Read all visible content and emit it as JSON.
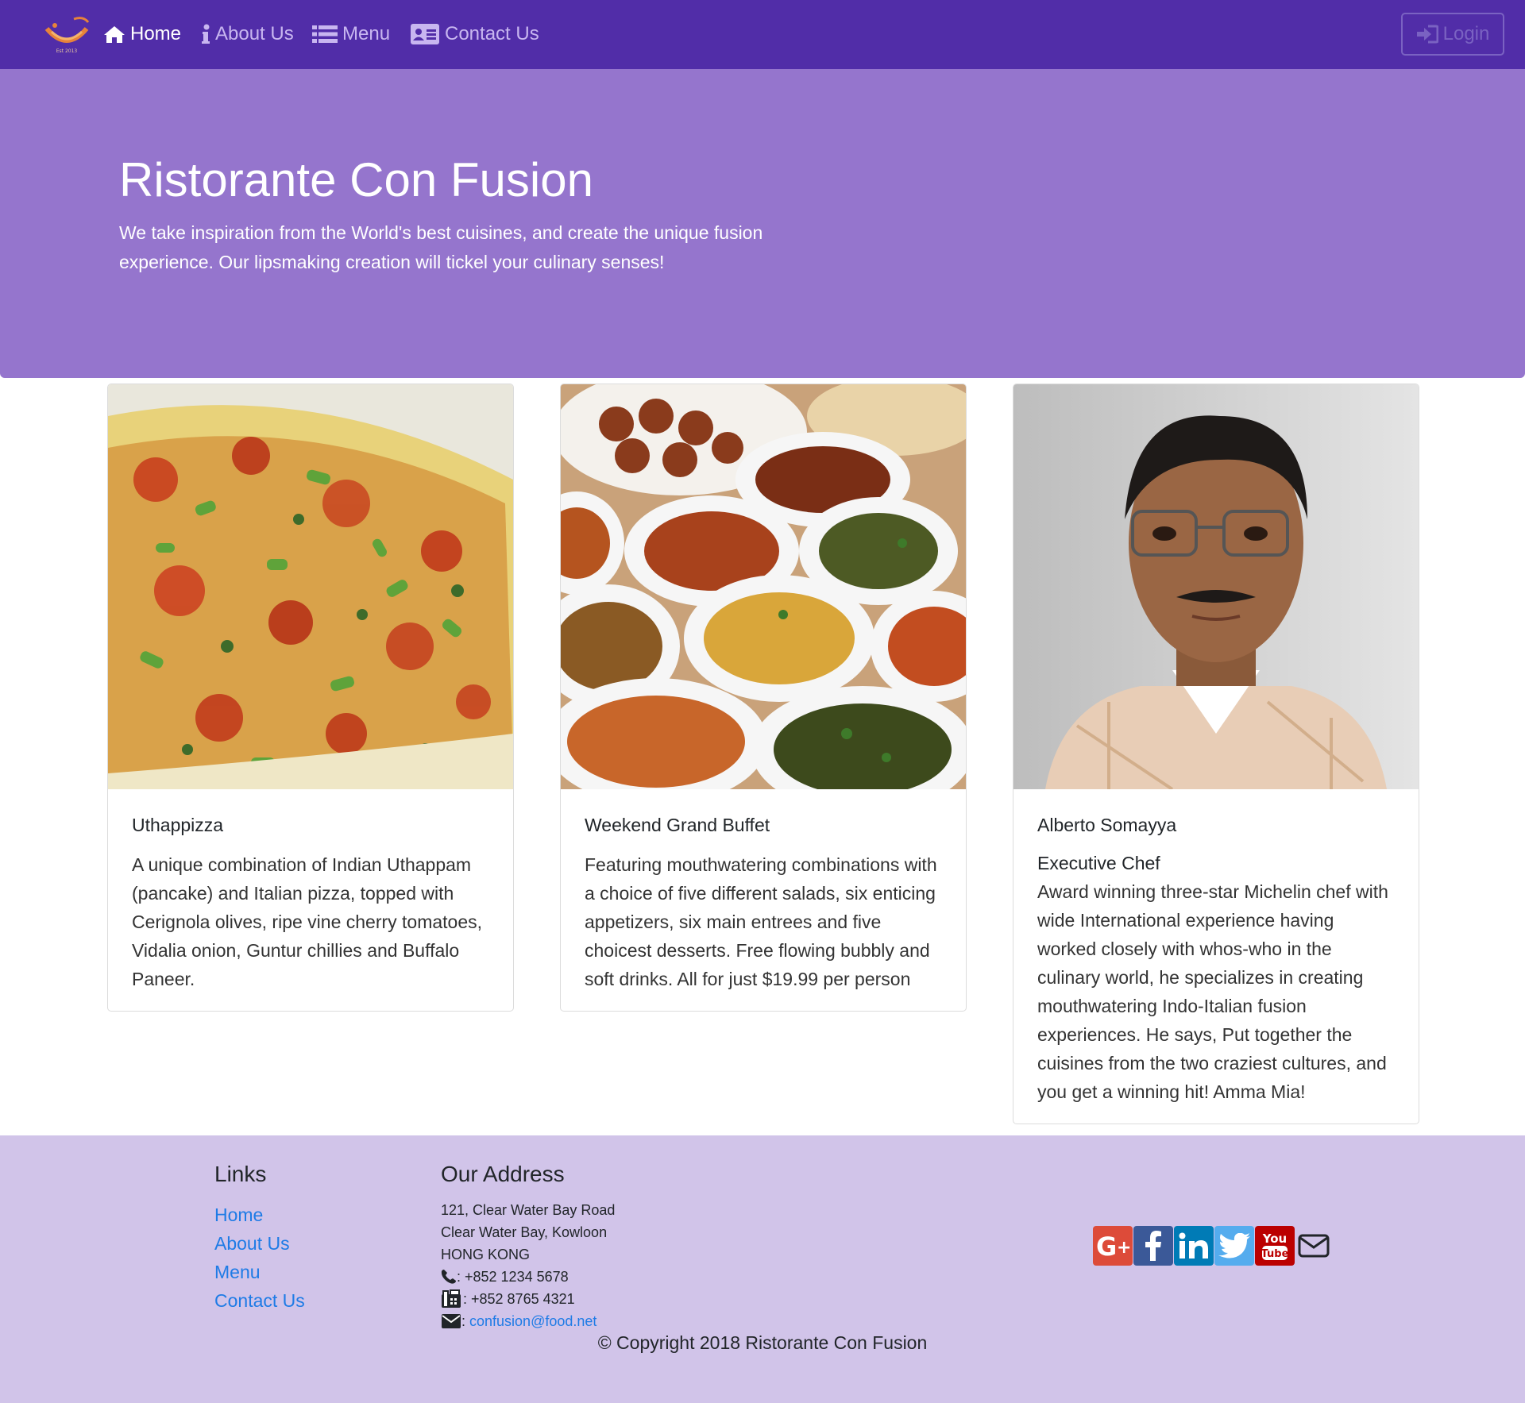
{
  "nav": {
    "items": [
      {
        "label": "Home",
        "icon": "home-icon",
        "active": true
      },
      {
        "label": "About Us",
        "icon": "info-icon",
        "active": false
      },
      {
        "label": "Menu",
        "icon": "list-icon",
        "active": false
      },
      {
        "label": "Contact Us",
        "icon": "address-card-icon",
        "active": false
      }
    ],
    "login_label": "Login",
    "background": "#512da8"
  },
  "jumbotron": {
    "title": "Ristorante Con Fusion",
    "text": "We take inspiration from the World's best cuisines, and create the unique fusion experience. Our lipsmaking creation will tickel your culinary senses!",
    "background": "#9575cd"
  },
  "cards": [
    {
      "title": "Uthappizza",
      "text": "A unique combination of Indian Uthappam (pancake) and Italian pizza, topped with Cerignola olives, ripe vine cherry tomatoes, Vidalia onion, Guntur chillies and Buffalo Paneer."
    },
    {
      "title": "Weekend Grand Buffet",
      "text": "Featuring mouthwatering combinations with a choice of five different salads, six enticing appetizers, six main entrees and five choicest desserts. Free flowing bubbly and soft drinks. All for just $19.99 per person"
    },
    {
      "title": "Alberto Somayya",
      "subtitle": "Executive Chef",
      "text": "Award winning three-star Michelin chef with wide International experience having worked closely with whos-who in the culinary world, he specializes in creating mouthwatering Indo-Italian fusion experiences. He says, Put together the cuisines from the two craziest cultures, and you get a winning hit! Amma Mia!"
    }
  ],
  "footer": {
    "links_heading": "Links",
    "links": [
      "Home",
      "About Us",
      "Menu",
      "Contact Us"
    ],
    "address_heading": "Our Address",
    "address_lines": [
      "121, Clear Water Bay Road",
      "Clear Water Bay, Kowloon",
      "HONG KONG"
    ],
    "phone": ": +852 1234 5678",
    "fax": ": +852 8765 4321",
    "email_prefix": ": ",
    "email": "confusion@food.net",
    "social": [
      {
        "name": "google-plus",
        "label": "G+",
        "color": "#dd4b39"
      },
      {
        "name": "facebook",
        "label": "f",
        "color": "#3b5998"
      },
      {
        "name": "linkedin",
        "label": "in",
        "color": "#007bb6"
      },
      {
        "name": "twitter",
        "label": "twitter",
        "color": "#55acee"
      },
      {
        "name": "youtube",
        "label": "You Tube",
        "color": "#bb0000"
      }
    ],
    "copyright": "© Copyright 2018 Ristorante Con Fusion",
    "background": "#d1c4e9"
  }
}
